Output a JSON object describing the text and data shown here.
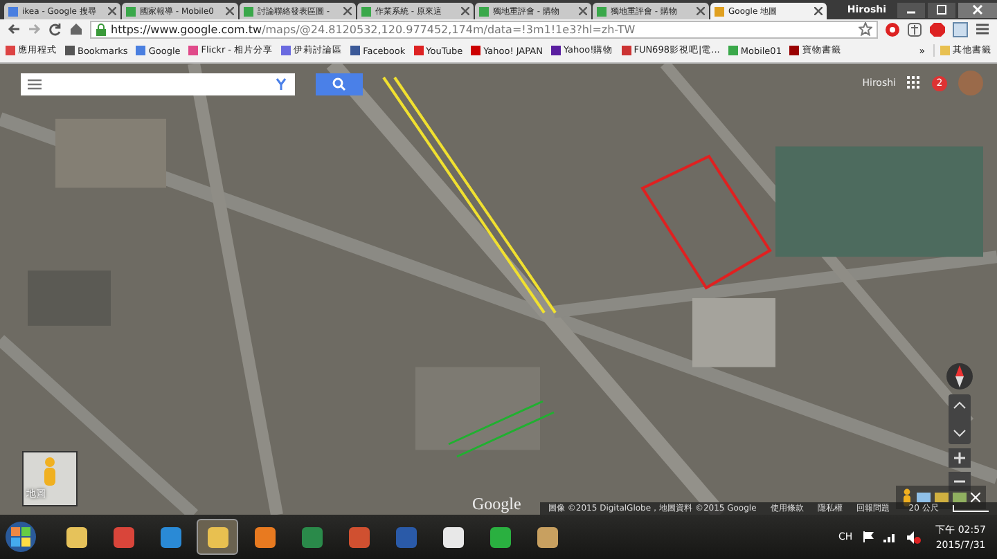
{
  "tabs": [
    {
      "title": "ikea - Google 搜尋",
      "kind": "google",
      "selected": false
    },
    {
      "title": "國家報導 - Mobile0",
      "kind": "m01",
      "selected": false
    },
    {
      "title": "討論聯絡發表區圖 -",
      "kind": "m01",
      "selected": false
    },
    {
      "title": "作業系統 - 原來這",
      "kind": "m01",
      "selected": false
    },
    {
      "title": "獨地重評會 - 購物",
      "kind": "m01",
      "selected": false
    },
    {
      "title": "獨地重評會 - 購物",
      "kind": "m01",
      "selected": false
    },
    {
      "title": "Google 地圖",
      "kind": "maps",
      "selected": true
    }
  ],
  "window": {
    "user": "Hiroshi"
  },
  "address_bar": {
    "host": "https://www.google.com.tw",
    "path": "/maps/@24.8120532,120.977452,174m/data=!3m1!1e3?hl=zh-TW"
  },
  "bookmarks": [
    {
      "label": "應用程式",
      "kind": "apps"
    },
    {
      "label": "Bookmarks",
      "kind": "star"
    },
    {
      "label": "Google",
      "kind": "google"
    },
    {
      "label": "Flickr - 相片分享",
      "kind": "flickr"
    },
    {
      "label": "伊莉討論區",
      "kind": "page"
    },
    {
      "label": "Facebook",
      "kind": "facebook"
    },
    {
      "label": "YouTube",
      "kind": "youtube"
    },
    {
      "label": "Yahoo! JAPAN",
      "kind": "yahoojp"
    },
    {
      "label": "Yahoo!購物",
      "kind": "yahoo"
    },
    {
      "label": "FUN698影視吧|電...",
      "kind": "fun"
    },
    {
      "label": "Mobile01",
      "kind": "m01"
    },
    {
      "label": "寶物書籤",
      "kind": "red"
    }
  ],
  "more_bookmarks": "»",
  "other_bookmarks": "其他書籤",
  "map": {
    "user": "Hiroshi",
    "notifications": "2",
    "mode_label": "地圖",
    "logo": "Google",
    "attribution": [
      "圖像 ©2015 DigitalGlobe，地圖資料 ©2015 Google",
      "使用條款",
      "隱私權",
      "回報問題"
    ],
    "scale": "20 公尺"
  },
  "taskbar": {
    "apps": [
      {
        "kind": "mail",
        "selected": false
      },
      {
        "kind": "chrome",
        "selected": false
      },
      {
        "kind": "ie",
        "selected": false
      },
      {
        "kind": "folder",
        "selected": true
      },
      {
        "kind": "media",
        "selected": false
      },
      {
        "kind": "excel",
        "selected": false
      },
      {
        "kind": "powerpoint",
        "selected": false
      },
      {
        "kind": "word",
        "selected": false
      },
      {
        "kind": "grid",
        "selected": false
      },
      {
        "kind": "line",
        "selected": false
      },
      {
        "kind": "paint",
        "selected": false
      }
    ],
    "language": "CH",
    "time": "下午 02:57",
    "date": "2015/7/31"
  }
}
